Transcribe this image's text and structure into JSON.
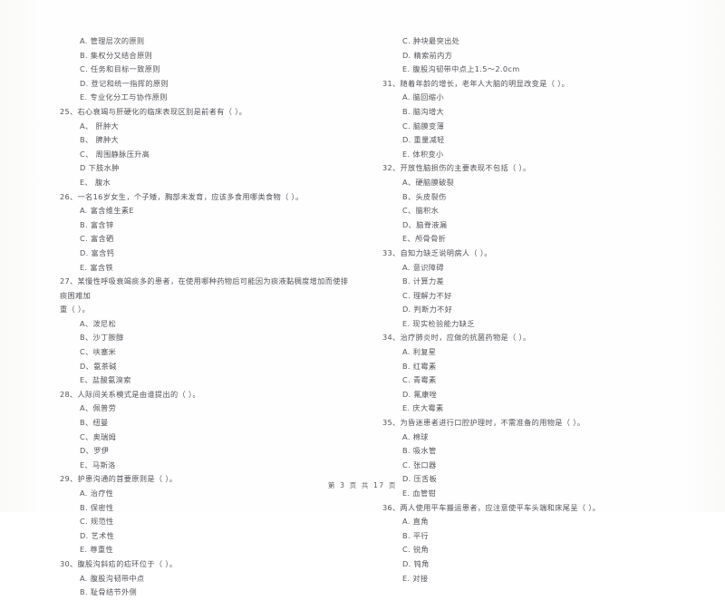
{
  "document": {
    "footer": "第 3 页  共 17 页"
  },
  "left_column": {
    "orphan_options": [
      "A. 管理层次的原则",
      "B. 集权分又结合原则",
      "C. 任务和目标一致原则",
      "D. 登记和统一指挥的原则",
      "E. 专业化分工与协作原则"
    ],
    "questions": [
      {
        "number": "25、",
        "stem": "右心衰竭与肝硬化的临床表现区别是前者有（    ）。",
        "options": [
          "A、 肝肿大",
          "B、 脾肿大",
          "C、 周围静脉压升高",
          "D  下肢水肿",
          "E、 腹水"
        ]
      },
      {
        "number": "26、",
        "stem": "一名16岁女生，个子矮，胸部未发育，应该多食用哪类食物（    ）。",
        "options": [
          "A. 富含维生素E",
          "B. 富含锌",
          "C. 富含硒",
          "D. 富含钙",
          "E. 富含铁"
        ]
      },
      {
        "number": "27、",
        "stem": "某慢性呼吸衰竭痰多的患者，在使用哪种药物后可能因为痰液黏稠度增加而使排痰困难加",
        "stem_continued": "重（    ）。",
        "options": [
          "A、泼尼松",
          "B、沙丁胺醇",
          "C、呋塞米",
          "D、氨茶碱",
          "E、盐酸氨溴索"
        ]
      },
      {
        "number": "28、",
        "stem": "人际间关系模式是由谁提出的（    ）。",
        "options": [
          "A、佩普劳",
          "B、纽曼",
          "C、奥瑞姆",
          "D、罗伊",
          "E、马斯洛"
        ]
      },
      {
        "number": "29、",
        "stem": "护患沟通的首要原则是（    ）。",
        "options": [
          "A. 治疗性",
          "B. 保密性",
          "C. 规范性",
          "D. 艺术性",
          "E. 尊重性"
        ]
      },
      {
        "number": "30、",
        "stem": "腹股沟斜疝的疝环位于（    ）。",
        "options": [
          "A. 腹股沟韧带中点",
          "B. 耻骨结节外侧"
        ]
      }
    ]
  },
  "right_column": {
    "orphan_options": [
      "C. 肿块最突出处",
      "D. 精索前内方",
      "E. 腹股沟韧带中点上1.5～2.0cm"
    ],
    "questions": [
      {
        "number": "31、",
        "stem": "随着年龄的增长，老年人大脑的明显改变是（    ）。",
        "options": [
          "A. 脑回缩小",
          "B. 脑沟增大",
          "C. 脑膜变薄",
          "D. 重量减轻",
          "E. 体积变小"
        ]
      },
      {
        "number": "32、",
        "stem": "开放性脑损伤的主要表现不包括（    ）。",
        "options": [
          "A、硬脑膜破裂",
          "B、头皮裂伤",
          "C、脑积水",
          "D、脑脊液漏",
          "E、颅骨骨折"
        ]
      },
      {
        "number": "33、",
        "stem": "自知力缺乏说明病人（    ）。",
        "options": [
          "A. 意识障碍",
          "B. 计算力差",
          "C. 理解力不好",
          "D. 判断力不好",
          "E. 现实检验能力缺乏"
        ]
      },
      {
        "number": "34、",
        "stem": "治疗肺炎时，应做的抗菌药物是（    ）。",
        "options": [
          "A. 利复星",
          "B. 红霉素",
          "C. 青霉素",
          "D. 氟康唑",
          "E. 庆大霉素"
        ]
      },
      {
        "number": "35、",
        "stem": "为昏迷患者进行口腔护理时，不需准备的用物是（    ）。",
        "options": [
          "A. 棉球",
          "B. 吸水管",
          "C. 张口器",
          "D. 压舌板",
          "E. 血管钳"
        ]
      },
      {
        "number": "36、",
        "stem": "两人使用平车搬运患者，应注意使平车头端和床尾呈（    ）。",
        "options": [
          "A. 直角",
          "B. 平行",
          "C. 锐角",
          "D. 钝角",
          "E. 对接"
        ]
      }
    ]
  }
}
